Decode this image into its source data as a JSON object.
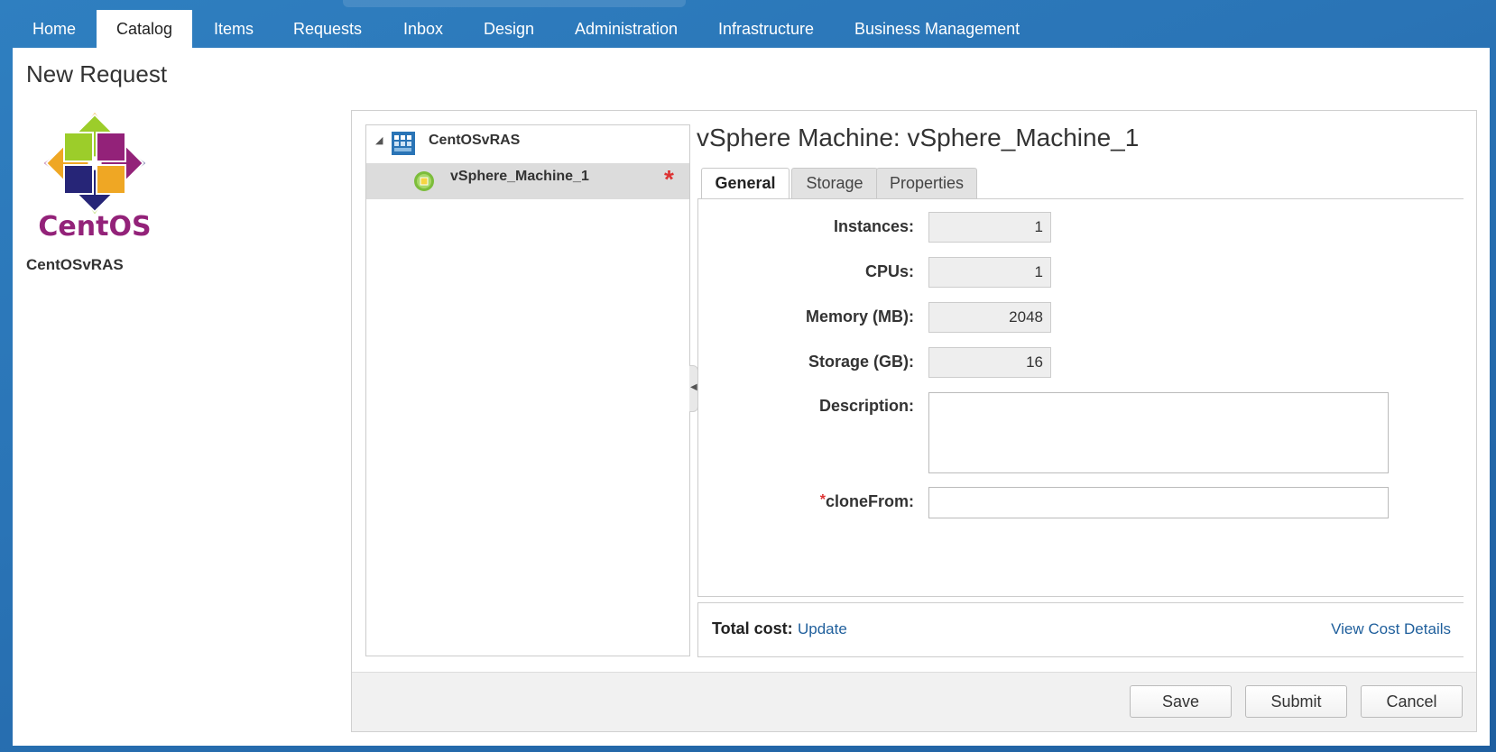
{
  "nav": {
    "tabs": [
      {
        "label": "Home"
      },
      {
        "label": "Catalog"
      },
      {
        "label": "Items"
      },
      {
        "label": "Requests"
      },
      {
        "label": "Inbox"
      },
      {
        "label": "Design"
      },
      {
        "label": "Administration"
      },
      {
        "label": "Infrastructure"
      },
      {
        "label": "Business Management"
      }
    ],
    "active": "Catalog"
  },
  "page": {
    "title": "New Request",
    "logo_icon": "centos-logo",
    "logo_text": "CentOS",
    "item_name": "CentOSvRAS"
  },
  "tree": {
    "root_label": "CentOSvRAS",
    "root_icon": "blueprint-icon",
    "child_label": "vSphere_Machine_1",
    "child_icon": "machine-icon",
    "child_required_marker": "*"
  },
  "detail": {
    "title": "vSphere Machine: vSphere_Machine_1",
    "tabs": [
      {
        "label": "General"
      },
      {
        "label": "Storage"
      },
      {
        "label": "Properties"
      }
    ],
    "active_tab": "General",
    "fields": {
      "instances": {
        "label": "Instances:",
        "value": "1"
      },
      "cpus": {
        "label": "CPUs:",
        "value": "1"
      },
      "memory": {
        "label": "Memory (MB):",
        "value": "2048"
      },
      "storage": {
        "label": "Storage (GB):",
        "value": "16"
      },
      "description": {
        "label": "Description:",
        "value": ""
      },
      "clone_from": {
        "label": "cloneFrom:",
        "value": "",
        "required_marker": "*"
      }
    }
  },
  "cost": {
    "label": "Total cost:",
    "update_link": "Update",
    "details_link": "View Cost Details"
  },
  "buttons": {
    "save": "Save",
    "submit": "Submit",
    "cancel": "Cancel"
  },
  "colors": {
    "nav_background": "#2a74b6",
    "link": "#1f5f9c",
    "required": "#d33333"
  }
}
